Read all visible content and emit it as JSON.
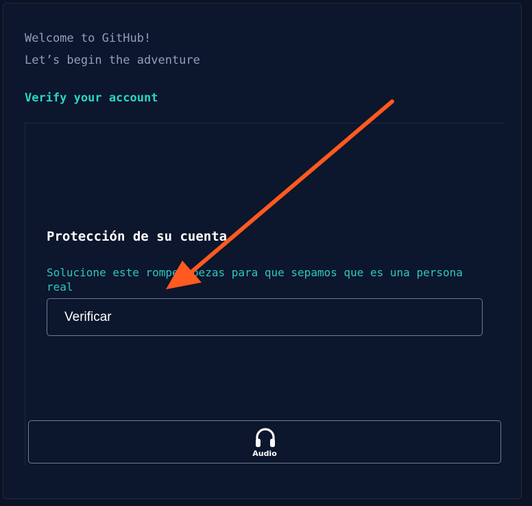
{
  "header": {
    "welcome_line1": "Welcome to GitHub!",
    "welcome_line2": "Let’s begin the adventure",
    "verify_title": "Verify your account"
  },
  "puzzle": {
    "title": "Protección de su cuenta",
    "description": "Solucione este rompecabezas para que sepamos que es una persona real",
    "verify_button_label": "Verificar",
    "audio_button_label": "Audio",
    "audio_icon": "headphones-icon"
  },
  "annotation": {
    "arrow_color": "#ff5a1f",
    "arrow_icon": "arrow-annotation"
  },
  "colors": {
    "background": "#0b1325",
    "accent": "#2bd4c3",
    "muted_text": "#8ea0bd"
  }
}
